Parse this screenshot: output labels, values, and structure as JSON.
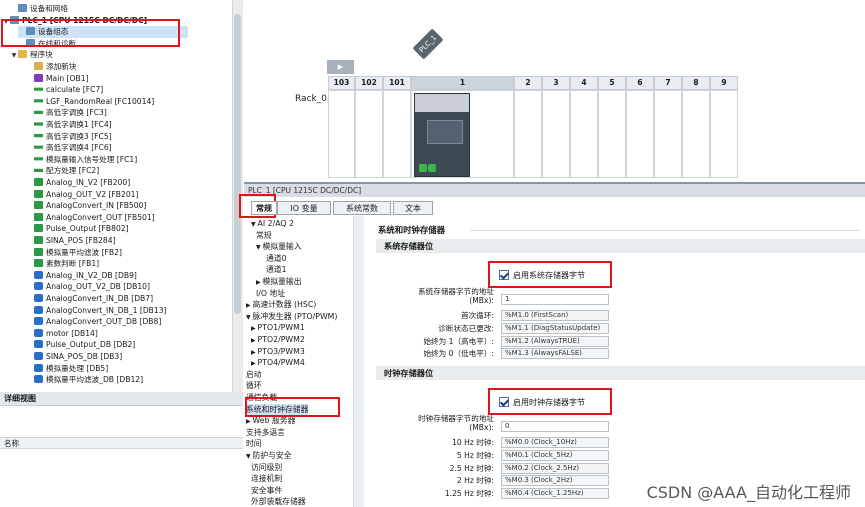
{
  "tree": {
    "items": [
      {
        "label": "设备和网络",
        "indent": 1,
        "icon": "dev",
        "tri": ""
      },
      {
        "label": "PLC_1 [CPU 1215C DC/DC/DC]",
        "indent": 0,
        "icon": "dev",
        "tri": "▼",
        "bold": true
      },
      {
        "label": "设备组态",
        "indent": 2,
        "icon": "dev",
        "tri": "",
        "selected": true
      },
      {
        "label": "在线和诊断",
        "indent": 2,
        "icon": "dev",
        "tri": ""
      },
      {
        "label": "程序块",
        "indent": 1,
        "icon": "fold",
        "tri": "▼"
      },
      {
        "label": "添加新块",
        "indent": 3,
        "icon": "add",
        "tri": ""
      },
      {
        "label": "Main [OB1]",
        "indent": 3,
        "icon": "ob",
        "tri": ""
      },
      {
        "label": "calculate [FC7]",
        "indent": 3,
        "icon": "fc",
        "tri": ""
      },
      {
        "label": "LGF_RandomReal [FC10014]",
        "indent": 3,
        "icon": "fc",
        "tri": ""
      },
      {
        "label": "高低字调换 [FC3]",
        "indent": 3,
        "icon": "fc",
        "tri": ""
      },
      {
        "label": "高低字调换1 [FC4]",
        "indent": 3,
        "icon": "fc",
        "tri": ""
      },
      {
        "label": "高低字调换3 [FC5]",
        "indent": 3,
        "icon": "fc",
        "tri": ""
      },
      {
        "label": "高低字调换4 [FC6]",
        "indent": 3,
        "icon": "fc",
        "tri": ""
      },
      {
        "label": "模拟量输入信号处理 [FC1]",
        "indent": 3,
        "icon": "fc",
        "tri": ""
      },
      {
        "label": "配方处理 [FC2]",
        "indent": 3,
        "icon": "fc",
        "tri": ""
      },
      {
        "label": "Analog_IN_V2 [FB200]",
        "indent": 3,
        "icon": "fc2",
        "tri": ""
      },
      {
        "label": "Analog_OUT_V2 [FB201]",
        "indent": 3,
        "icon": "fc2",
        "tri": ""
      },
      {
        "label": "AnalogConvert_IN [FB500]",
        "indent": 3,
        "icon": "fc2",
        "tri": ""
      },
      {
        "label": "AnalogConvert_OUT [FB501]",
        "indent": 3,
        "icon": "fc2",
        "tri": ""
      },
      {
        "label": "Pulse_Output [FB802]",
        "indent": 3,
        "icon": "fc2",
        "tri": ""
      },
      {
        "label": "SINA_POS [FB284]",
        "indent": 3,
        "icon": "fc2",
        "tri": ""
      },
      {
        "label": "模拟量平均滤波 [FB2]",
        "indent": 3,
        "icon": "fc2",
        "tri": ""
      },
      {
        "label": "素数判断 [FB1]",
        "indent": 3,
        "icon": "fc2",
        "tri": ""
      },
      {
        "label": "Analog_IN_V2_DB [DB9]",
        "indent": 3,
        "icon": "db",
        "tri": ""
      },
      {
        "label": "Analog_OUT_V2_DB [DB10]",
        "indent": 3,
        "icon": "db",
        "tri": ""
      },
      {
        "label": "AnalogConvert_IN_DB [DB7]",
        "indent": 3,
        "icon": "db",
        "tri": ""
      },
      {
        "label": "AnalogConvert_IN_DB_1 [DB13]",
        "indent": 3,
        "icon": "db",
        "tri": ""
      },
      {
        "label": "AnalogConvert_OUT_DB [DB8]",
        "indent": 3,
        "icon": "db",
        "tri": ""
      },
      {
        "label": "motor [DB14]",
        "indent": 3,
        "icon": "db",
        "tri": ""
      },
      {
        "label": "Pulse_Output_DB [DB2]",
        "indent": 3,
        "icon": "db",
        "tri": ""
      },
      {
        "label": "SINA_POS_DB [DB3]",
        "indent": 3,
        "icon": "db",
        "tri": ""
      },
      {
        "label": "模拟量处理 [DB5]",
        "indent": 3,
        "icon": "db",
        "tri": ""
      },
      {
        "label": "模拟量平均滤波_DB [DB12]",
        "indent": 3,
        "icon": "db",
        "tri": ""
      }
    ]
  },
  "detail": {
    "title": "详细视图",
    "col_name": "名称"
  },
  "device": {
    "plc_tag": "PLC_1",
    "rack_label": "Rack_0",
    "slots": [
      "103",
      "102",
      "101",
      "1",
      "2",
      "3",
      "4",
      "5",
      "6",
      "7",
      "8",
      "9"
    ]
  },
  "props": {
    "title": "PLC_1 [CPU 1215C DC/DC/DC]",
    "tabs": [
      "常规",
      "IO 变量",
      "系统常数",
      "文本"
    ],
    "nav": [
      {
        "label": "AI 2/AQ 2",
        "indent": 1,
        "tri": "▼"
      },
      {
        "label": "常规",
        "indent": 2,
        "tri": ""
      },
      {
        "label": "模拟量输入",
        "indent": 2,
        "tri": "▼"
      },
      {
        "label": "通道0",
        "indent": 4,
        "tri": ""
      },
      {
        "label": "通道1",
        "indent": 4,
        "tri": ""
      },
      {
        "label": "模拟量输出",
        "indent": 2,
        "tri": "▶"
      },
      {
        "label": "I/O 地址",
        "indent": 2,
        "tri": ""
      },
      {
        "label": "高速计数器 (HSC)",
        "indent": 0,
        "tri": "▶"
      },
      {
        "label": "脉冲发生器 (PTO/PWM)",
        "indent": 0,
        "tri": "▼"
      },
      {
        "label": "PTO1/PWM1",
        "indent": 1,
        "tri": "▶"
      },
      {
        "label": "PTO2/PWM2",
        "indent": 1,
        "tri": "▶"
      },
      {
        "label": "PTO3/PWM3",
        "indent": 1,
        "tri": "▶"
      },
      {
        "label": "PTO4/PWM4",
        "indent": 1,
        "tri": "▶"
      },
      {
        "label": "启动",
        "indent": 0,
        "tri": ""
      },
      {
        "label": "循环",
        "indent": 0,
        "tri": ""
      },
      {
        "label": "通信负载",
        "indent": 0,
        "tri": ""
      },
      {
        "label": "系统和时钟存储器",
        "indent": 0,
        "tri": "",
        "selected": true
      },
      {
        "label": "Web 服务器",
        "indent": 0,
        "tri": "▶"
      },
      {
        "label": "支持多语言",
        "indent": 0,
        "tri": ""
      },
      {
        "label": "时间",
        "indent": 0,
        "tri": ""
      },
      {
        "label": "防护与安全",
        "indent": 0,
        "tri": "▼"
      },
      {
        "label": "访问级别",
        "indent": 1,
        "tri": ""
      },
      {
        "label": "连接机制",
        "indent": 1,
        "tri": ""
      },
      {
        "label": "安全事件",
        "indent": 1,
        "tri": ""
      },
      {
        "label": "外部装载存储器",
        "indent": 1,
        "tri": ""
      }
    ],
    "section_title": "系统和时钟存储器",
    "sys": {
      "title": "系统存储器位",
      "enable_label": "启用系统存储器字节",
      "addr_label1": "系统存储器字节的地址",
      "addr_label2": "(MBx):",
      "addr_value": "1",
      "rows": [
        {
          "label": "首次循环:",
          "value": "%M1.0 (FirstScan)"
        },
        {
          "label": "诊断状态已更改:",
          "value": "%M1.1 (DiagStatusUpdate)"
        },
        {
          "label": "始终为 1（高电平）:",
          "value": "%M1.2 (AlwaysTRUE)"
        },
        {
          "label": "始终为 0（低电平）:",
          "value": "%M1.3 (AlwaysFALSE)"
        }
      ]
    },
    "clk": {
      "title": "时钟存储器位",
      "enable_label": "启用时钟存储器字节",
      "addr_label1": "时钟存储器字节的地址",
      "addr_label2": "(MBx):",
      "addr_value": "0",
      "rows": [
        {
          "label": "10 Hz 时钟:",
          "value": "%M0.0 (Clock_10Hz)"
        },
        {
          "label": "5 Hz 时钟:",
          "value": "%M0.1 (Clock_5Hz)"
        },
        {
          "label": "2.5 Hz 时钟:",
          "value": "%M0.2 (Clock_2.5Hz)"
        },
        {
          "label": "2 Hz 时钟:",
          "value": "%M0.3 (Clock_2Hz)"
        },
        {
          "label": "1.25 Hz 时钟:",
          "value": "%M0.4 (Clock_1.25Hz)"
        }
      ]
    }
  },
  "watermark": "CSDN @AAA_自动化工程师"
}
